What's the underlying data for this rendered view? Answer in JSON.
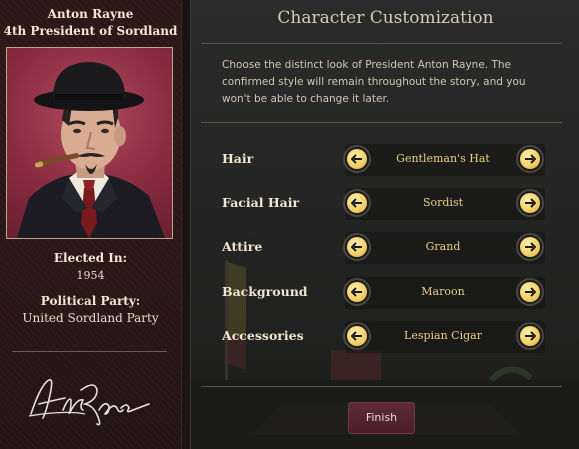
{
  "president": {
    "name": "Anton Rayne",
    "title": "4th President of Sordland",
    "elected_label": "Elected In:",
    "elected_year": "1954",
    "party_label": "Political Party:",
    "party_name": "United Sordland Party",
    "signature_icon": "signature-icon"
  },
  "panel": {
    "title": "Character Customization",
    "description": "Choose the distinct look of President Anton Rayne. The confirmed style will remain throughout the story, and you won't be able to change it later."
  },
  "options": [
    {
      "label": "Hair",
      "value": "Gentleman's Hat"
    },
    {
      "label": "Facial Hair",
      "value": "Sordist"
    },
    {
      "label": "Attire",
      "value": "Grand"
    },
    {
      "label": "Background",
      "value": "Maroon"
    },
    {
      "label": "Accessories",
      "value": "Lespian Cigar"
    }
  ],
  "buttons": {
    "finish_label": "Finish",
    "prev_icon": "arrow-left-icon",
    "next_icon": "arrow-right-icon"
  },
  "colors": {
    "accent_gold": "#f3d16a",
    "left_panel_bg": "#2c1717",
    "portrait_bg": "#8a2c40",
    "finish_button": "#5e2a35"
  }
}
